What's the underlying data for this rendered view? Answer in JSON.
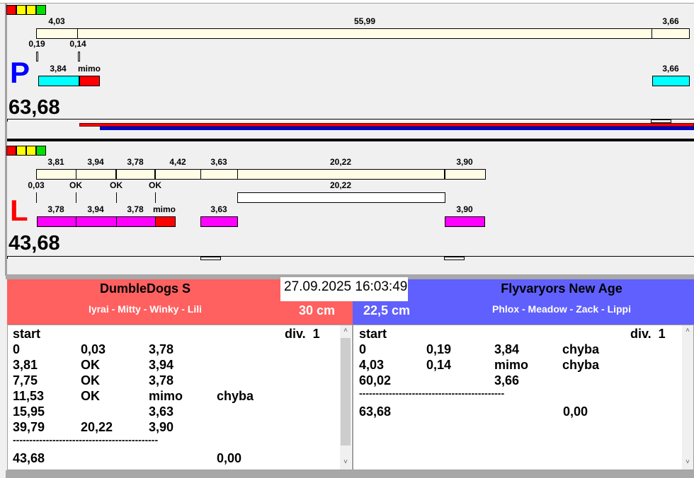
{
  "colors": {
    "status": [
      "#ff0000",
      "#ffff00",
      "#ffff00",
      "#00e000"
    ],
    "track": "#fffde6",
    "cyan": "#00ffff",
    "magenta": "#ff00ff",
    "miss": "#ff0000",
    "left_team": "#ff6060",
    "right_team": "#6060ff"
  },
  "lane_p": {
    "letter": "P",
    "total": "63,68",
    "top_labels": [
      "4,03",
      "55,99",
      "3,66"
    ],
    "mid_labels": [
      "0,19",
      "0,14"
    ],
    "bottom_labels": [
      "3,84",
      "mimo",
      "3,66"
    ]
  },
  "lane_l": {
    "letter": "L",
    "total": "43,68",
    "top_labels": [
      "3,81",
      "3,94",
      "3,78",
      "4,42",
      "3,63",
      "20,22",
      "3,90"
    ],
    "mid_labels": [
      "0,03",
      "OK",
      "OK",
      "OK",
      "20,22"
    ],
    "bottom_labels": [
      "3,78",
      "3,94",
      "3,78",
      "mimo",
      "3,63",
      "3,90"
    ]
  },
  "datetime": "27.09.2025 16:03:49",
  "left_team": {
    "name": "DumbleDogs S",
    "dogs": "Iyrai - Mitty - Winky - Lili",
    "height": "30 cm",
    "header": [
      "start",
      "div.  1"
    ],
    "rows": [
      [
        "0",
        "0,03",
        "3,78",
        ""
      ],
      [
        "3,81",
        "OK",
        "3,94",
        ""
      ],
      [
        "7,75",
        "OK",
        "3,78",
        ""
      ],
      [
        "11,53",
        "OK",
        "mimo",
        "chyba"
      ],
      [
        "15,95",
        "",
        "3,63",
        ""
      ],
      [
        "39,79",
        "20,22",
        "3,90",
        ""
      ]
    ],
    "separator": "--------------------------------------------",
    "total": [
      "43,68",
      "",
      "",
      "0,00"
    ]
  },
  "right_team": {
    "name": "Flyvaryors New Age",
    "dogs": "Phlox - Meadow - Zack - Lippi",
    "height": "22,5 cm",
    "header": [
      "start",
      "div.  1"
    ],
    "rows": [
      [
        "0",
        "0,19",
        "3,84",
        "chyba"
      ],
      [
        "4,03",
        "0,14",
        "mimo",
        "chyba"
      ],
      [
        "60,02",
        "",
        "3,66",
        ""
      ]
    ],
    "separator": "--------------------------------------------",
    "total": [
      "63,68",
      "",
      "",
      "0,00"
    ]
  },
  "scroll": {
    "up": "˄",
    "down": "˅"
  }
}
